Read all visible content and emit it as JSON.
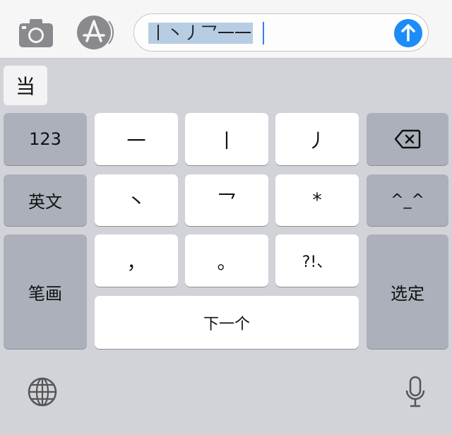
{
  "top_bar": {
    "camera_icon": "camera-icon",
    "appstore_icon": "app-store-icon",
    "input_text": "丨丶丿乛一一",
    "send_icon": "arrow-up-icon"
  },
  "candidates": [
    "当"
  ],
  "keyboard": {
    "row1": [
      "123",
      "一",
      "丨",
      "丿"
    ],
    "delete_icon": "delete-backward-icon",
    "row2": [
      "英文",
      "丶",
      "乛",
      "*",
      "^_^"
    ],
    "row3": [
      "，",
      "。",
      "?!、"
    ],
    "stroke_label": "笔画",
    "select_label": "选定",
    "next_label": "下一个"
  },
  "bottom": {
    "globe_icon": "globe-icon",
    "mic_icon": "microphone-icon"
  },
  "colors": {
    "send": "#1d8cf8",
    "function_key": "#abb0bb",
    "letter_key": "#ffffff",
    "keyboard_bg": "#d1d3d9"
  }
}
